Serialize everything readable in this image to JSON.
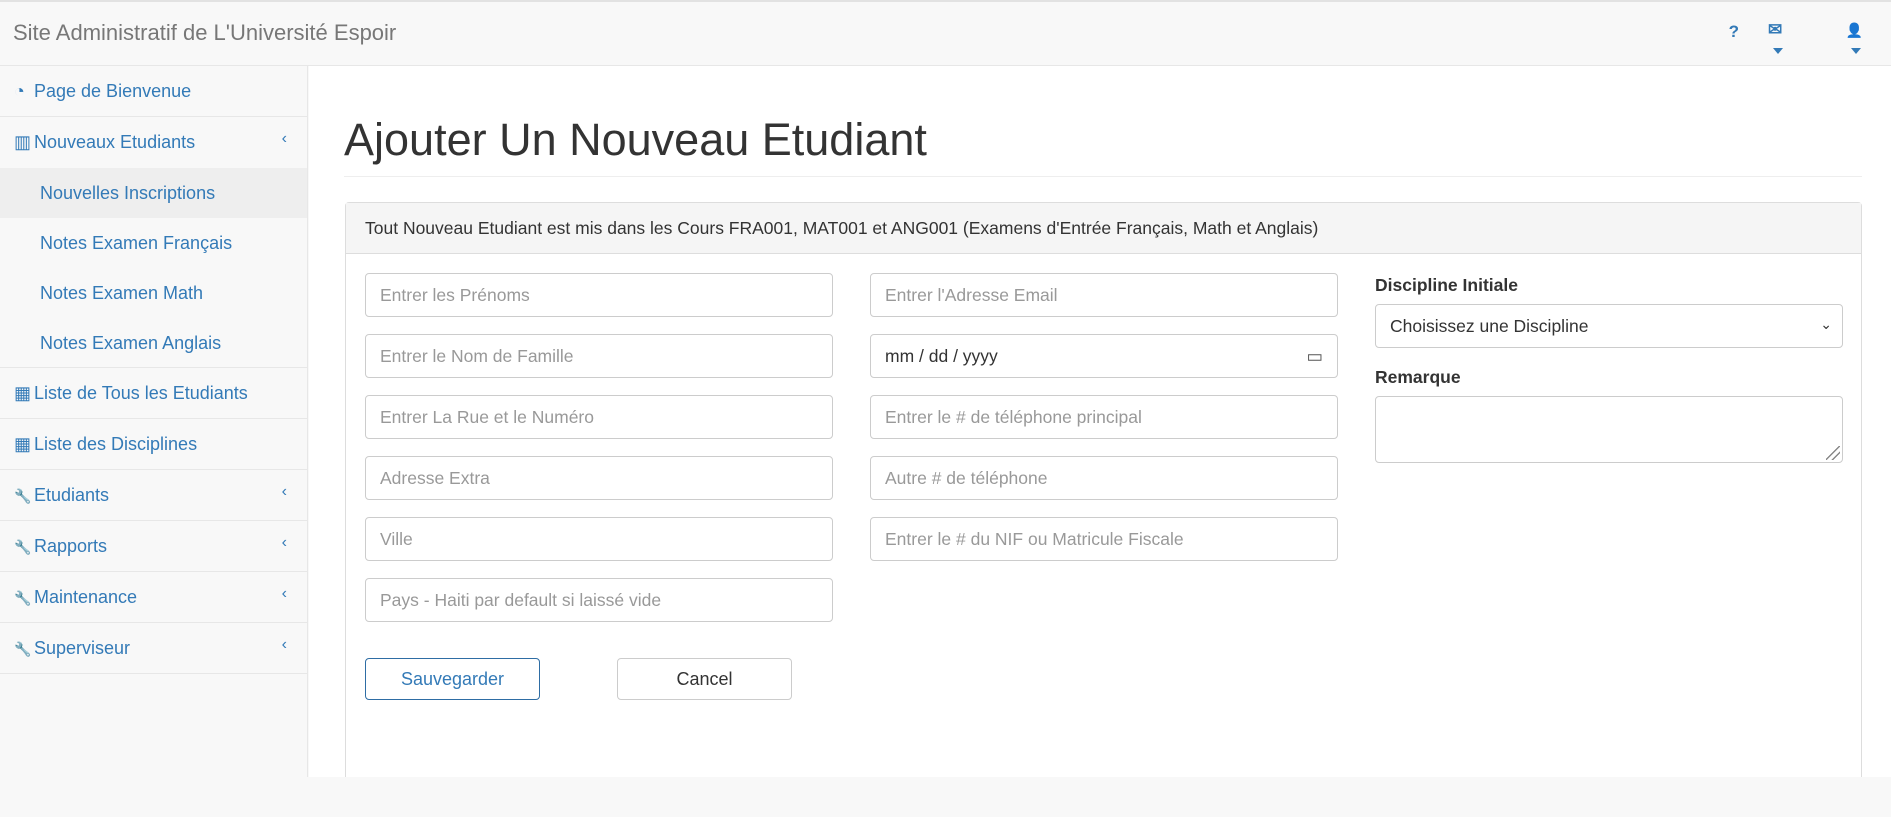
{
  "app": {
    "title": "Site Administratif de L'Université Espoir"
  },
  "navbar": {
    "help_icon": "question-icon",
    "mail_icon": "envelope-icon",
    "user_icon": "user-icon",
    "help_glyph": "?",
    "mail_glyph": "✉",
    "user_glyph": "👤"
  },
  "sidebar": {
    "items": [
      {
        "label": "Page de Bienvenue",
        "icon": "dashboard-icon",
        "glyph": "◔"
      },
      {
        "label": "Nouveaux Etudiants",
        "icon": "bar-chart-icon",
        "glyph": "▥",
        "chevron": "‹",
        "children": [
          {
            "label": "Nouvelles Inscriptions"
          },
          {
            "label": "Notes Examen Français"
          },
          {
            "label": "Notes Examen Math"
          },
          {
            "label": "Notes Examen Anglais"
          }
        ]
      },
      {
        "label": "Liste de Tous les Etudiants",
        "icon": "table-icon",
        "glyph": "▦"
      },
      {
        "label": "Liste des Disciplines",
        "icon": "table-icon",
        "glyph": "▦"
      },
      {
        "label": "Etudiants",
        "icon": "wrench-icon",
        "glyph": "🔧",
        "chevron": "‹"
      },
      {
        "label": "Rapports",
        "icon": "wrench-icon",
        "glyph": "🔧",
        "chevron": "‹"
      },
      {
        "label": "Maintenance",
        "icon": "wrench-icon",
        "glyph": "🔧",
        "chevron": "‹"
      },
      {
        "label": "Superviseur",
        "icon": "wrench-icon",
        "glyph": "🔧",
        "chevron": "‹"
      }
    ]
  },
  "page": {
    "title": "Ajouter Un Nouveau Etudiant",
    "notice": "Tout Nouveau Etudiant est mis dans les Cours FRA001, MAT001 et ANG001 (Examens d'Entrée Français, Math et Anglais)"
  },
  "form": {
    "first_names_placeholder": "Entrer les Prénoms",
    "last_name_placeholder": "Entrer le Nom de Famille",
    "street_placeholder": "Entrer La Rue et le Numéro",
    "address_extra_placeholder": "Adresse Extra",
    "city_placeholder": "Ville",
    "country_placeholder": "Pays - Haiti par default si laissé vide",
    "email_placeholder": "Entrer l'Adresse Email",
    "date_value": "mm / dd / yyyy",
    "calendar_glyph": "▭",
    "phone_main_placeholder": "Entrer le # de téléphone principal",
    "phone_other_placeholder": "Autre # de téléphone",
    "nif_placeholder": "Entrer le # du NIF ou Matricule Fiscale",
    "discipline_label": "Discipline Initiale",
    "discipline_selected": "Choisissez une Discipline",
    "select_chevron": "⌄",
    "remark_label": "Remarque",
    "save_label": "Sauvegarder",
    "cancel_label": "Cancel"
  }
}
